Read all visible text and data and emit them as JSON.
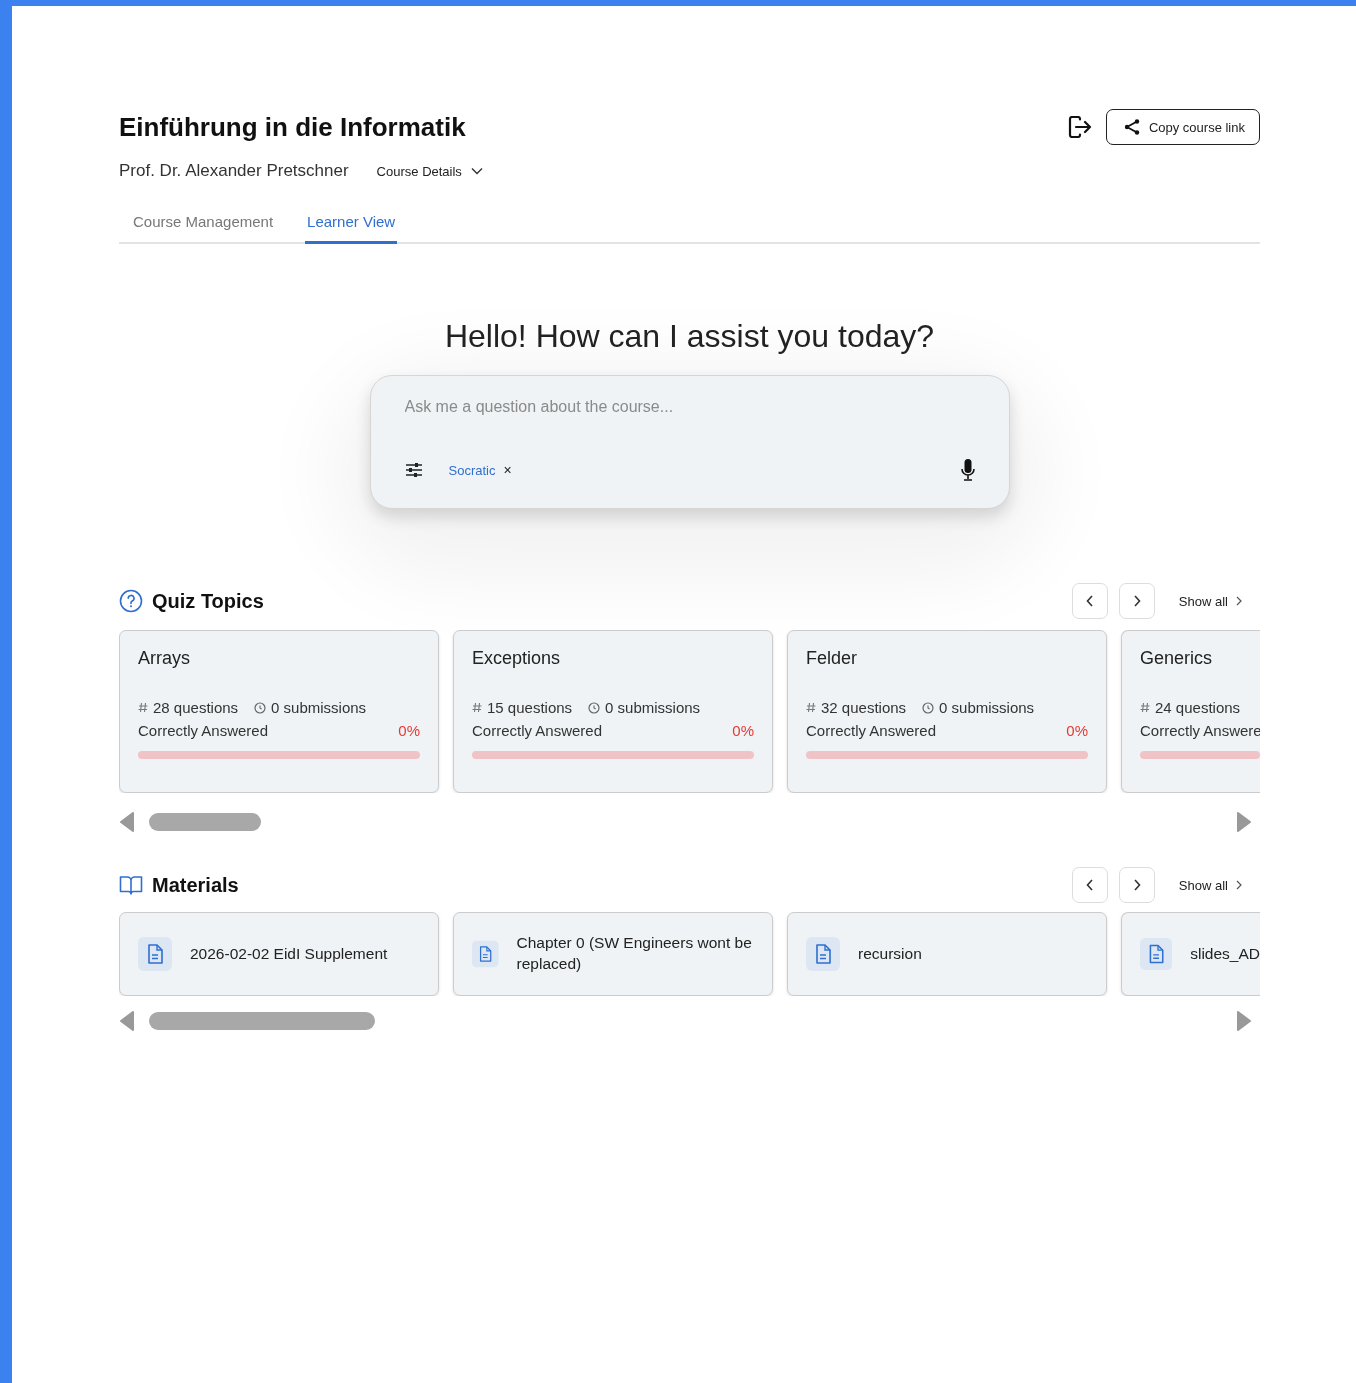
{
  "course": {
    "title": "Einführung in die Informatik",
    "instructor": "Prof. Dr. Alexander Pretschner",
    "details_button": "Course Details",
    "copy_link_button": "Copy course link"
  },
  "tabs": [
    {
      "label": "Course Management",
      "selected": false
    },
    {
      "label": "Learner View",
      "selected": true
    }
  ],
  "assistant": {
    "heading": "Hello! How can I assist you today?",
    "placeholder": "Ask me a question about the course...",
    "mode_chip": "Socratic",
    "chip_remove": "×"
  },
  "quiz_topics": {
    "title": "Quiz Topics",
    "show_all": "Show all",
    "items": [
      {
        "name": "Arrays",
        "questions": "28 questions",
        "submissions": "0 submissions",
        "correct_label": "Correctly Answered",
        "percent": "0%",
        "level": 0
      },
      {
        "name": "Exceptions",
        "questions": "15 questions",
        "submissions": "0 submissions",
        "correct_label": "Correctly Answered",
        "percent": "0%",
        "level": 0
      },
      {
        "name": "Felder",
        "questions": "32 questions",
        "submissions": "0 submissions",
        "correct_label": "Correctly Answered",
        "percent": "0%",
        "level": 0
      },
      {
        "name": "Generics",
        "questions": "24 questions",
        "correct_label": "Correctly Answere",
        "level": 0
      }
    ]
  },
  "materials": {
    "title": "Materials",
    "show_all": "Show all",
    "items": [
      {
        "name": "2026-02-02 EidI Supplement"
      },
      {
        "name": "Chapter 0 (SW Engineers wont be replaced)"
      },
      {
        "name": "recursion"
      },
      {
        "name": "slides_AD"
      }
    ]
  }
}
